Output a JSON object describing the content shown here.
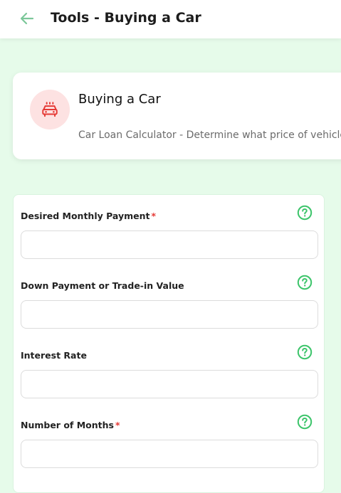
{
  "header": {
    "title": "Tools - Buying a Car",
    "back_icon": "arrow-left-icon"
  },
  "info_card": {
    "icon": "car-icon",
    "title": "Buying a Car",
    "subtitle": "Car Loan Calculator - Determine what price of vehicle"
  },
  "form": {
    "fields": [
      {
        "label": "Desired Monthly Payment",
        "required": true,
        "value": "",
        "placeholder": ""
      },
      {
        "label": "Down Payment or Trade-in Value",
        "required": false,
        "value": "",
        "placeholder": ""
      },
      {
        "label": "Interest Rate",
        "required": false,
        "value": "",
        "placeholder": ""
      },
      {
        "label": "Number of Months",
        "required": true,
        "value": "",
        "placeholder": ""
      }
    ],
    "required_marker": "*",
    "help_icon": "question-circle-icon"
  },
  "colors": {
    "page_bg": "#e6fbea",
    "accent_green": "#3cc46a",
    "back_arrow": "#7cc79a",
    "required_red": "#e53935",
    "car_icon_red": "#e53935",
    "car_badge_bg": "#fde2e2"
  }
}
